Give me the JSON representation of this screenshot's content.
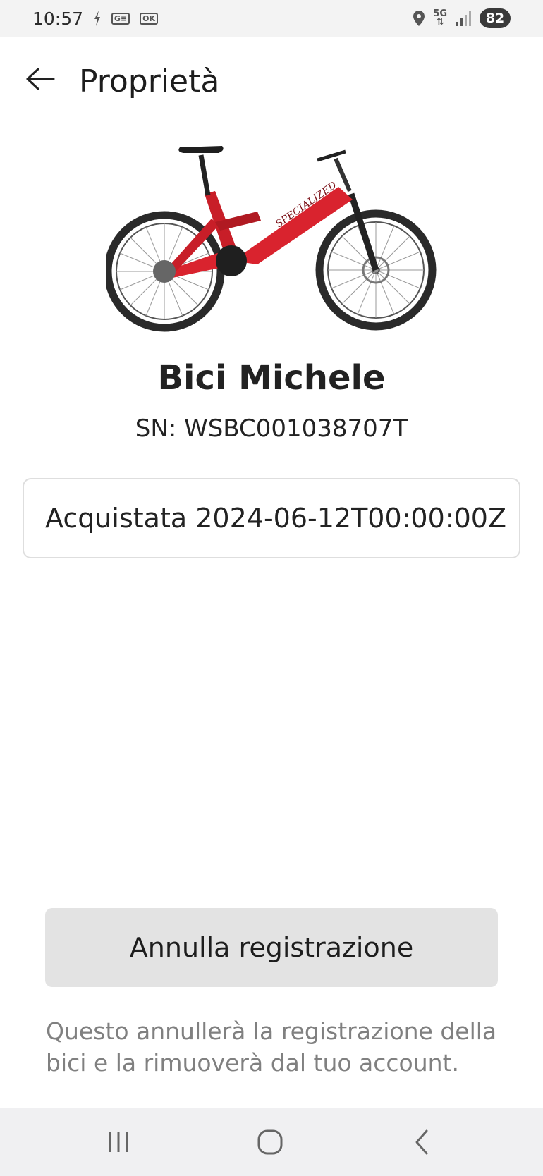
{
  "status_bar": {
    "time": "10:57",
    "icons": [
      "bolt-icon",
      "notification-g-icon",
      "notification-ok-icon"
    ],
    "right_icons": [
      "location-icon",
      "5g-icon",
      "signal-icon"
    ],
    "network": "5G",
    "battery": "82"
  },
  "header": {
    "back_icon": "arrow-left-icon",
    "title": "Proprietà"
  },
  "bike": {
    "name": "Bici Michele",
    "serial": "SN: WSBC001038707T",
    "image": "red-e-mountain-bike"
  },
  "purchase": {
    "label": "Acquistata 2024-06-12T00:00:00Z"
  },
  "actions": {
    "unregister_label": "Annulla registrazione",
    "note": "Questo annullerà la registrazione della bici e la rimuoverà dal tuo account."
  },
  "nav_bar": {
    "items": [
      "recents-icon",
      "home-icon",
      "back-icon"
    ]
  },
  "colors": {
    "bike_red": "#d9232e",
    "button_bg": "#e3e3e3",
    "note_text": "#808080"
  }
}
